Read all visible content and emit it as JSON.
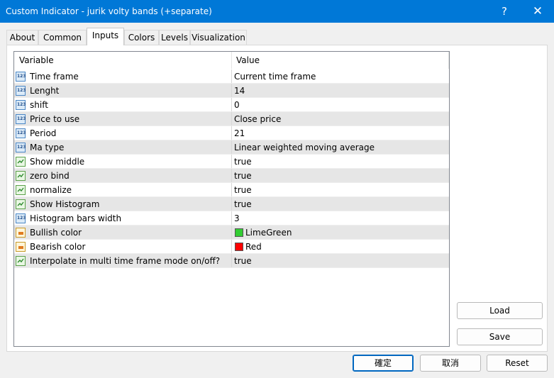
{
  "window": {
    "title": "Custom Indicator - jurik volty bands (+separate)",
    "help": "?",
    "close": "✕"
  },
  "tabs": [
    {
      "label": "About"
    },
    {
      "label": "Common"
    },
    {
      "label": "Inputs",
      "active": true
    },
    {
      "label": "Colors"
    },
    {
      "label": "Levels"
    },
    {
      "label": "Visualization"
    }
  ],
  "grid": {
    "col_variable": "Variable",
    "col_value": "Value",
    "rows": [
      {
        "type": "num",
        "name": "Time frame",
        "value": "Current time frame"
      },
      {
        "type": "num",
        "name": "Lenght",
        "value": "14"
      },
      {
        "type": "num",
        "name": "shift",
        "value": "0"
      },
      {
        "type": "num",
        "name": "Price to use",
        "value": "Close price"
      },
      {
        "type": "num",
        "name": "Period",
        "value": "21"
      },
      {
        "type": "num",
        "name": "Ma type",
        "value": "Linear weighted moving average"
      },
      {
        "type": "bool",
        "name": "Show middle",
        "value": "true"
      },
      {
        "type": "bool",
        "name": "zero bind",
        "value": "true"
      },
      {
        "type": "bool",
        "name": "normalize",
        "value": "true"
      },
      {
        "type": "bool",
        "name": "Show Histogram",
        "value": "true"
      },
      {
        "type": "num",
        "name": "Histogram bars width",
        "value": "3"
      },
      {
        "type": "color",
        "name": "Bullish color",
        "value": "LimeGreen",
        "swatch": "#32cd32"
      },
      {
        "type": "color",
        "name": "Bearish color",
        "value": "Red",
        "swatch": "#ff0000"
      },
      {
        "type": "bool",
        "name": "Interpolate in multi time frame mode on/off?",
        "value": "true"
      }
    ]
  },
  "buttons": {
    "load": "Load",
    "save": "Save",
    "ok": "確定",
    "cancel": "取消",
    "reset": "Reset"
  }
}
